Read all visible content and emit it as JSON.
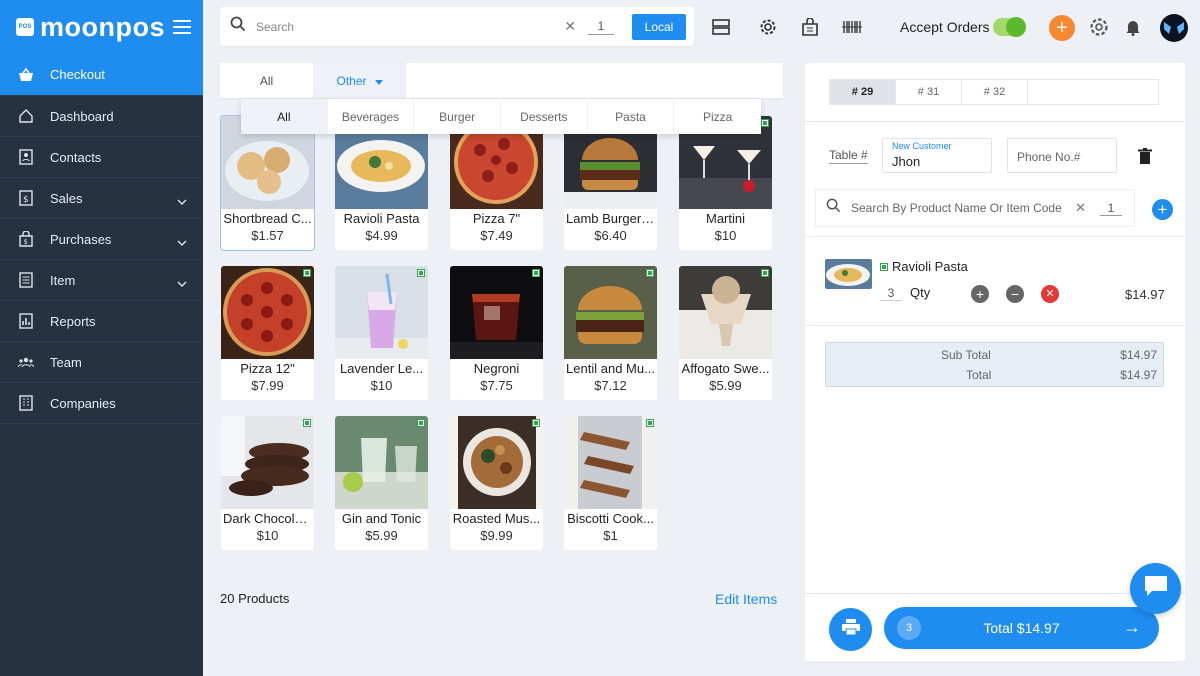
{
  "brand": {
    "name": "moonpos",
    "logo_text": "POS"
  },
  "sidebar": {
    "items": [
      {
        "label": "Checkout",
        "icon": "basket-icon",
        "active": true
      },
      {
        "label": "Dashboard",
        "icon": "home-icon"
      },
      {
        "label": "Contacts",
        "icon": "contacts-icon"
      },
      {
        "label": "Sales",
        "icon": "sales-icon",
        "expandable": true
      },
      {
        "label": "Purchases",
        "icon": "purchases-icon",
        "expandable": true
      },
      {
        "label": "Item",
        "icon": "item-icon",
        "expandable": true
      },
      {
        "label": "Reports",
        "icon": "reports-icon"
      },
      {
        "label": "Team",
        "icon": "team-icon"
      },
      {
        "label": "Companies",
        "icon": "companies-icon"
      }
    ]
  },
  "topbar": {
    "search_placeholder": "Search",
    "qty": "1",
    "local_label": "Local",
    "accept_orders_label": "Accept Orders",
    "accept_orders_on": true
  },
  "categories": {
    "tabs": [
      "All",
      "Other"
    ],
    "selected": "Other",
    "sub_tabs": [
      "All",
      "Beverages",
      "Burger",
      "Desserts",
      "Pasta",
      "Pizza"
    ],
    "selected_sub": "All"
  },
  "products": [
    {
      "name": "Shortbread C...",
      "price": "$1.57"
    },
    {
      "name": "Ravioli Pasta",
      "price": "$4.99"
    },
    {
      "name": "Pizza 7\"",
      "price": "$7.49"
    },
    {
      "name": "Lamb Burger ...",
      "price": "$6.40"
    },
    {
      "name": "Martini",
      "price": "$10"
    },
    {
      "name": "Pizza 12\"",
      "price": "$7.99"
    },
    {
      "name": "Lavender Le...",
      "price": "$10"
    },
    {
      "name": "Negroni",
      "price": "$7.75"
    },
    {
      "name": "Lentil and Mu...",
      "price": "$7.12"
    },
    {
      "name": "Affogato Swe...",
      "price": "$5.99"
    },
    {
      "name": "Dark Chocola...",
      "price": "$10"
    },
    {
      "name": "Gin and Tonic",
      "price": "$5.99"
    },
    {
      "name": "Roasted Mus...",
      "price": "$9.99"
    },
    {
      "name": "Biscotti Cook...",
      "price": "$1"
    }
  ],
  "footer": {
    "product_count": "20 Products",
    "edit_items": "Edit Items"
  },
  "order": {
    "tabs": [
      "# 29",
      "# 31",
      "# 32"
    ],
    "active_tab": "# 29",
    "table_label": "Table #",
    "customer_caption": "New Customer",
    "customer_name": "Jhon",
    "phone_placeholder": "Phone No.#",
    "product_search_placeholder": "Search By Product Name Or Item Code",
    "product_search_qty": "1",
    "cart": [
      {
        "name": "Ravioli Pasta",
        "qty": "3",
        "qty_label": "Qty",
        "price": "$14.97"
      }
    ],
    "subtotal_label": "Sub Total",
    "subtotal": "$14.97",
    "total_label": "Total",
    "total": "$14.97",
    "total_button": "Total $14.97",
    "item_count": "3"
  },
  "colors": {
    "primary": "#1f8cf0",
    "sidebar": "#263142",
    "accent_orange": "#f7882f",
    "veg_green": "#2fa84f",
    "danger": "#e53935"
  }
}
